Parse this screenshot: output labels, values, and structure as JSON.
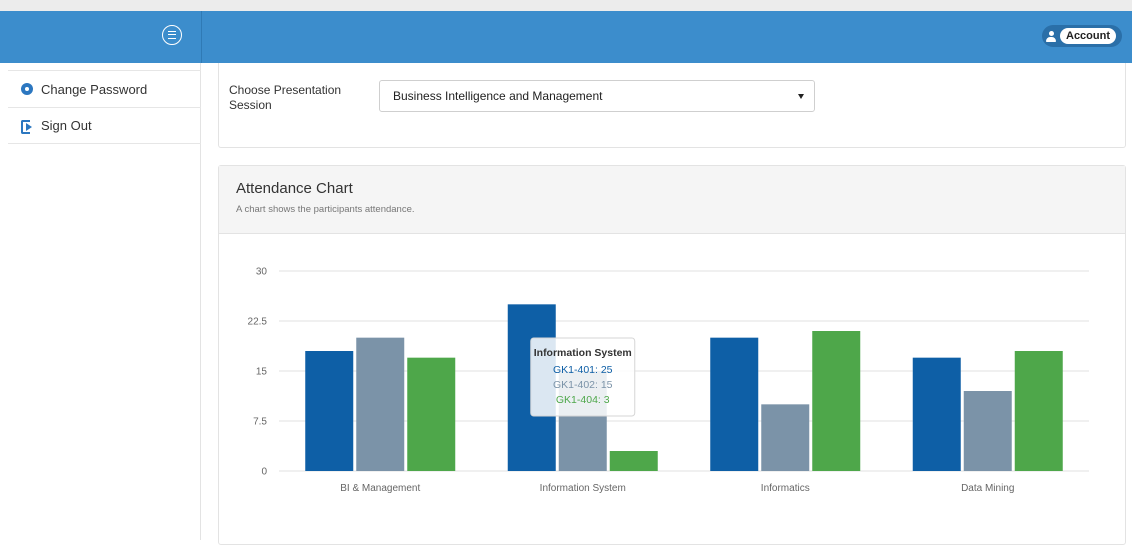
{
  "header": {
    "account_label": "Account",
    "colors": {
      "bar": "#3c8dcc",
      "accent": "#2c77c0"
    }
  },
  "sidebar": {
    "items": [
      {
        "label": "Change Password",
        "icon": "gear-icon"
      },
      {
        "label": "Sign Out",
        "icon": "sign-out-icon"
      }
    ]
  },
  "session": {
    "label": "Choose Presentation Session",
    "selected": "Business Intelligence and Management"
  },
  "chart_panel": {
    "title": "Attendance Chart",
    "subtitle": "A chart shows the participants attendance."
  },
  "chart_data": {
    "type": "bar",
    "categories": [
      "BI & Management",
      "Information System",
      "Informatics",
      "Data Mining"
    ],
    "series": [
      {
        "name": "GK1-401",
        "color": "#0e5fa6",
        "values": [
          18,
          25,
          20,
          17
        ]
      },
      {
        "name": "GK1-402",
        "color": "#7b93a8",
        "values": [
          20,
          15,
          10,
          12
        ]
      },
      {
        "name": "GK1-404",
        "color": "#4ea74a",
        "values": [
          17,
          3,
          21,
          18
        ]
      }
    ],
    "yticks": [
      "0",
      "7.5",
      "15",
      "22.5",
      "30"
    ],
    "ylim": [
      0,
      30
    ],
    "grid": true,
    "tooltip": {
      "title": "Information System",
      "lines": [
        "GK1-401: 25",
        "GK1-402: 15",
        "GK1-404: 3"
      ]
    }
  }
}
